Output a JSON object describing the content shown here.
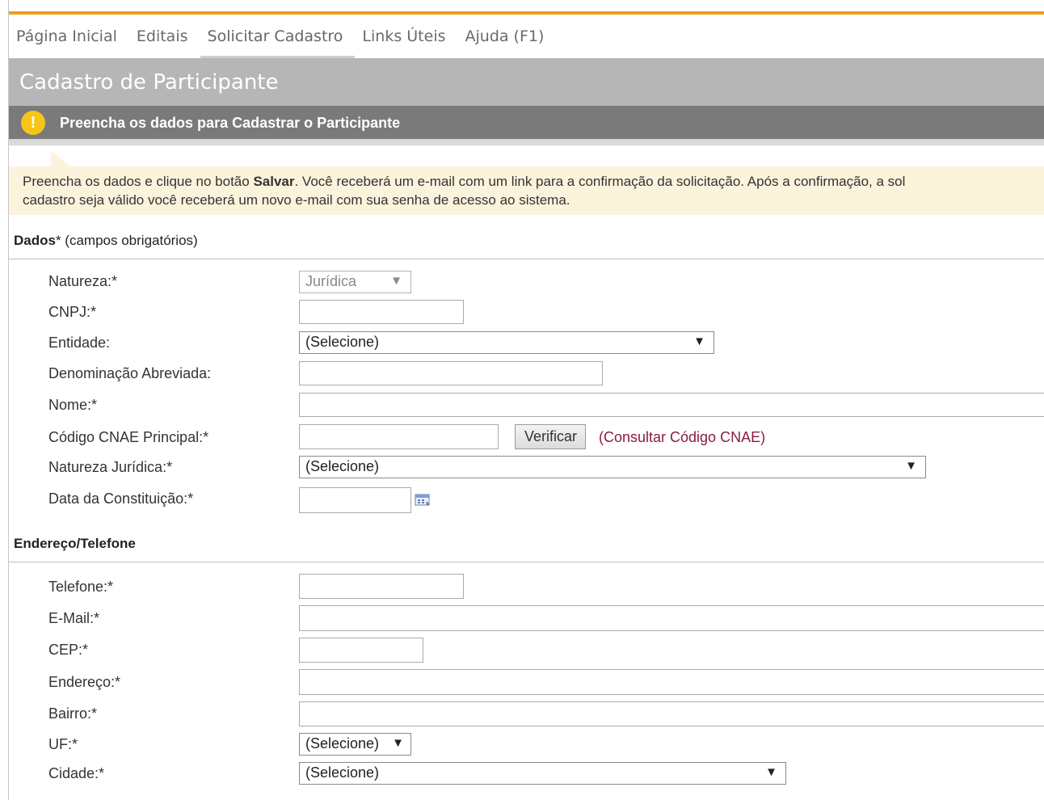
{
  "nav": {
    "tabs": [
      {
        "label": "Página Inicial"
      },
      {
        "label": "Editais"
      },
      {
        "label": "Solicitar Cadastro"
      },
      {
        "label": "Links Úteis"
      },
      {
        "label": "Ajuda (F1)"
      }
    ],
    "active_index": 2
  },
  "page": {
    "title": "Cadastro de Participante",
    "alert": "Preencha os dados para Cadastrar o Participante",
    "alert_icon": "exclamation-icon"
  },
  "info": {
    "line1_pre": "Preencha os dados e clique no botão ",
    "line1_bold": "Salvar",
    "line1_post": ". Você receberá um e-mail com um link para a confirmação da solicitação. Após a confirmação, a sol",
    "line2": "cadastro seja válido você receberá um novo e-mail com sua senha de acesso ao sistema."
  },
  "dados": {
    "heading": "Dados",
    "heading_suffix": "* (campos obrigatórios)",
    "natureza_label": "Natureza:*",
    "natureza_value": "Jurídica",
    "cnpj_label": "CNPJ:*",
    "entidade_label": "Entidade:",
    "entidade_value": "(Selecione)",
    "denominacao_label": "Denominação Abreviada:",
    "nome_label": "Nome:*",
    "cnae_label": "Código CNAE Principal:*",
    "verificar_button": "Verificar",
    "consultar_link": "(Consultar Código CNAE)",
    "natureza_juridica_label": "Natureza Jurídica:*",
    "natureza_juridica_value": "(Selecione)",
    "data_constituicao_label": "Data da Constituição:*",
    "calendar_icon": "calendar-icon"
  },
  "endereco": {
    "heading": "Endereço/Telefone",
    "telefone_label": "Telefone:*",
    "email_label": "E-Mail:*",
    "cep_label": "CEP:*",
    "endereco_label": "Endereço:*",
    "bairro_label": "Bairro:*",
    "uf_label": "UF:*",
    "uf_value": "(Selecione)",
    "cidade_label": "Cidade:*",
    "cidade_value": "(Selecione)"
  },
  "colors": {
    "accent_orange": "#f29c1f",
    "title_bar": "#b6b6b6",
    "alert_bar": "#7a7a7a",
    "alert_icon": "#f5c518",
    "info_bg": "#fbf3dc",
    "link": "#8b1c3f"
  }
}
